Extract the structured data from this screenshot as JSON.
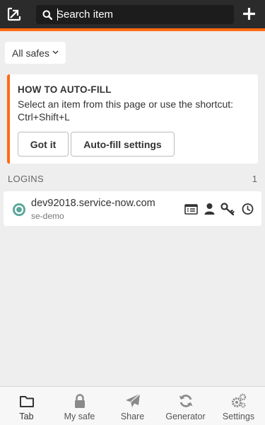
{
  "header": {
    "search_placeholder": "Search item"
  },
  "safes": {
    "selected": "All safes"
  },
  "autofill_card": {
    "title": "HOW TO AUTO-FILL",
    "text": "Select an item from this page or use the shortcut: Ctrl+Shift+L",
    "got_it_label": "Got it",
    "settings_label": "Auto-fill settings"
  },
  "logins": {
    "section_title": "LOGINS",
    "count": "1",
    "items": [
      {
        "title": "dev92018.service-now.com",
        "subtitle": "se-demo"
      }
    ]
  },
  "bottom_nav": [
    {
      "label": "Tab",
      "icon": "folder-icon"
    },
    {
      "label": "My safe",
      "icon": "lock-icon"
    },
    {
      "label": "Share",
      "icon": "paper-plane-icon"
    },
    {
      "label": "Generator",
      "icon": "refresh-icon"
    },
    {
      "label": "Settings",
      "icon": "gears-icon"
    }
  ],
  "colors": {
    "header_bg": "#2b2b2b",
    "accent": "#ff6a13",
    "avatar": "#5aa79a"
  }
}
